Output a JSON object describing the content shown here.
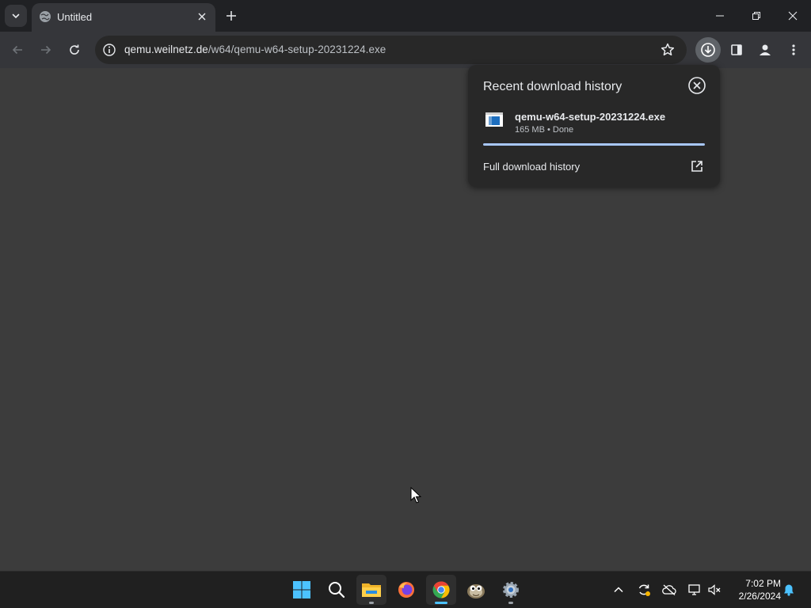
{
  "browser": {
    "tab": {
      "title": "Untitled"
    },
    "omnibox": {
      "url_host": "qemu.weilnetz.de",
      "url_path": "/w64/qemu-w64-setup-20231224.exe"
    }
  },
  "download_bubble": {
    "title": "Recent download history",
    "items": [
      {
        "file_name": "qemu-w64-setup-20231224.exe",
        "status": "165 MB • Done",
        "progress": 1.0
      }
    ],
    "full_history_label": "Full download history"
  },
  "taskbar": {
    "apps": [
      "windows-start",
      "search",
      "file-explorer",
      "firefox",
      "chrome",
      "gimp",
      "settings"
    ],
    "clock": {
      "time": "7:02 PM",
      "date": "2/26/2024"
    }
  },
  "colors": {
    "accent": "#a8c7fa",
    "page_bg": "#3c3c3c",
    "toolbar_bg": "#35363a",
    "tabstrip_bg": "#202124",
    "taskbar_bg": "#202020"
  }
}
